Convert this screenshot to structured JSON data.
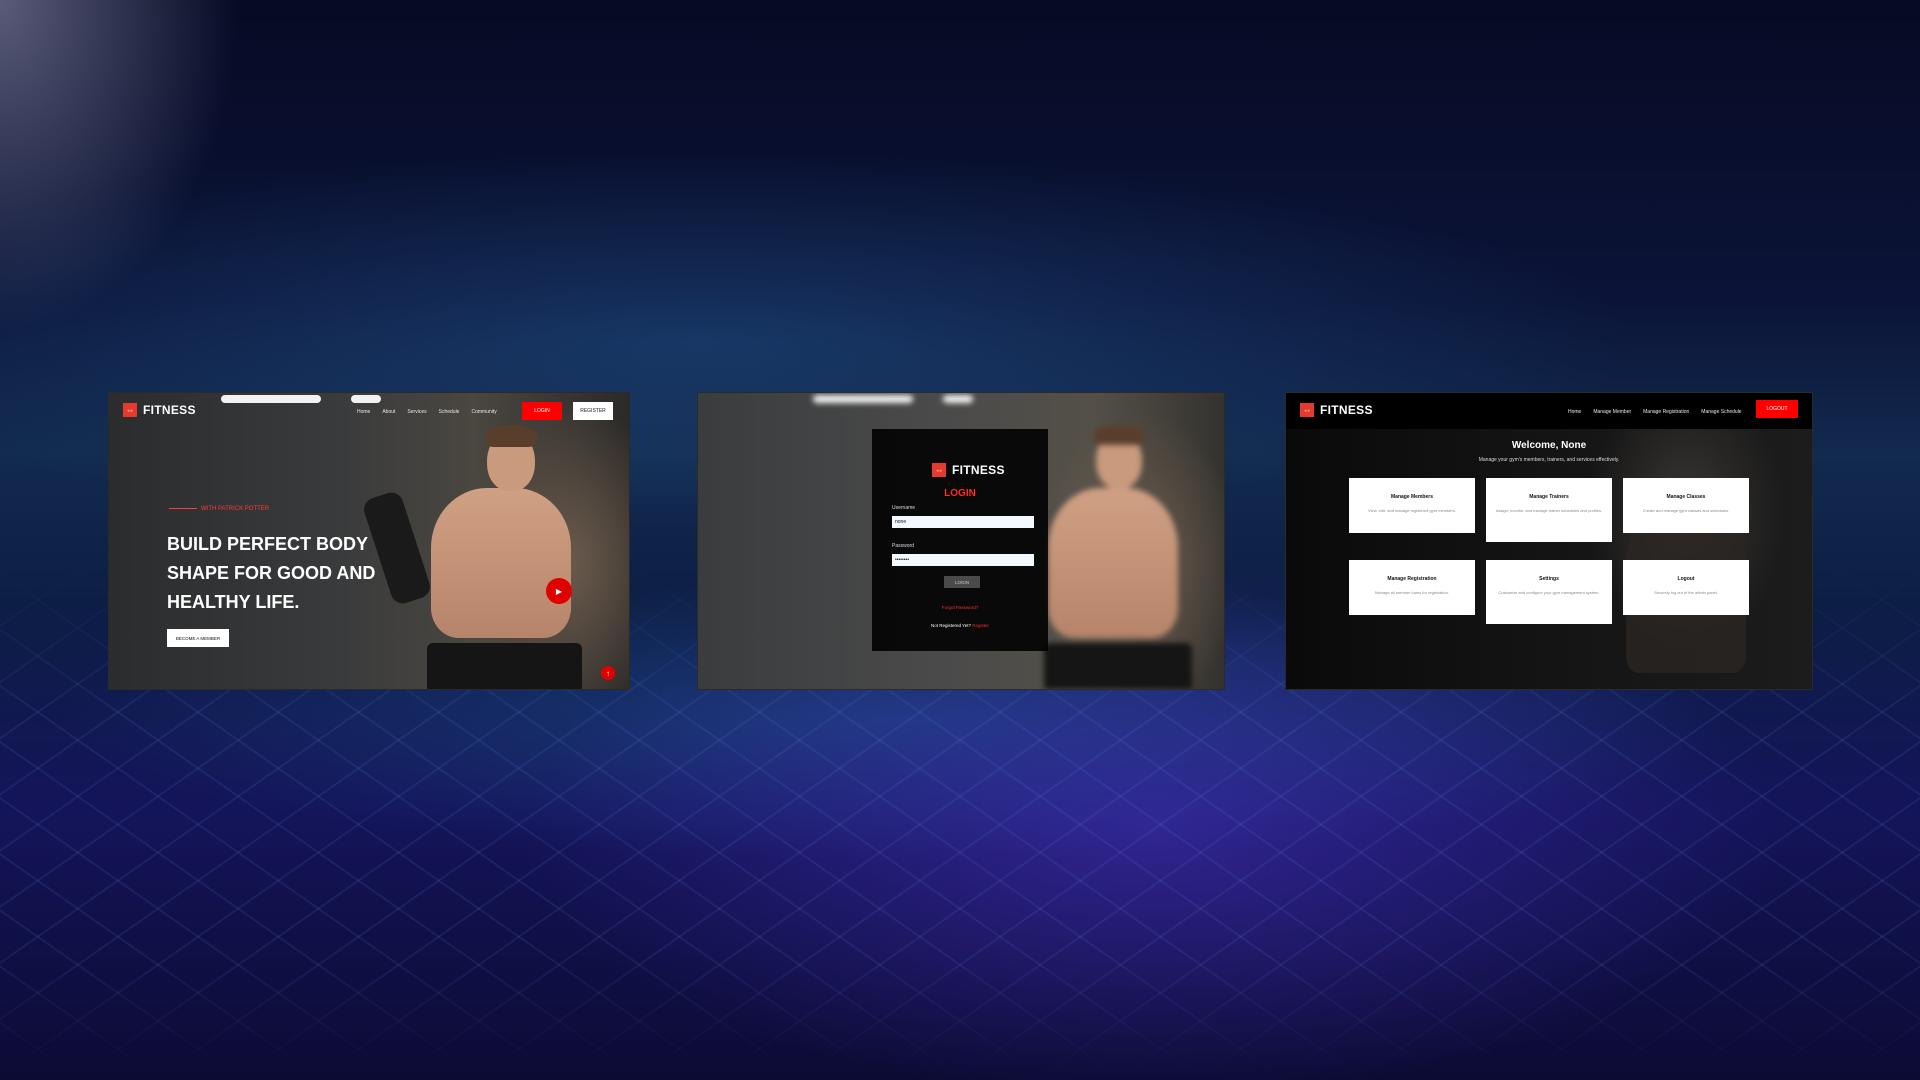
{
  "home": {
    "brand": "FITNESS",
    "brand_icon": "dumbbell-icon",
    "nav": [
      "Home",
      "About",
      "Services",
      "Schedule",
      "Community"
    ],
    "login_label": "LOGIN",
    "register_label": "REGISTER",
    "tagline": "WITH PATRICK POTTER",
    "hero_title": "BUILD PERFECT BODY SHAPE FOR GOOD AND HEALTHY LIFE.",
    "cta_label": "BECOME A MEMBER",
    "play_icon": "play-icon",
    "scroll_top_icon": "arrow-up-icon"
  },
  "login": {
    "brand": "FITNESS",
    "title": "LOGIN",
    "username_label": "Username",
    "username_value": "none",
    "password_label": "Password",
    "password_value": "••••••••",
    "button_label": "LOGIN",
    "forgot_label": "Forgot Password?",
    "register_prompt": "Not Registered Yet?",
    "register_link": "Register"
  },
  "dashboard": {
    "brand": "FITNESS",
    "nav": [
      "Home",
      "Manage Member",
      "Manage Registration",
      "Manage Schedule"
    ],
    "logout_label": "LOGOUT",
    "welcome": "Welcome, None",
    "subtitle": "Manage your gym's members, trainers, and services effectively.",
    "cards": [
      {
        "title": "Manage Members",
        "desc": "View, edit, and manage registered gym members."
      },
      {
        "title": "Manage Trainers",
        "desc": "Assign, monitor, and manage trainer schedules and profiles."
      },
      {
        "title": "Manage Classes",
        "desc": "Create and manage gym classes and schedules."
      },
      {
        "title": "Manage Registration",
        "desc": "Manage all member loans for registration."
      },
      {
        "title": "Settings",
        "desc": "Customize and configure your gym management system."
      },
      {
        "title": "Logout",
        "desc": "Securely log out of the admin panel."
      }
    ]
  },
  "colors": {
    "accent": "#ff0000",
    "brand_logo": "#e63a2e"
  }
}
